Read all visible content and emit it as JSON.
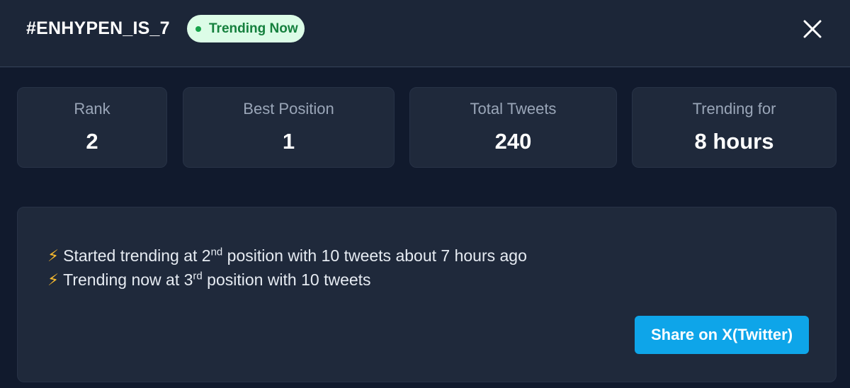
{
  "header": {
    "hashtag": "#ENHYPEN_IS_7",
    "badge_label": "Trending Now",
    "close_icon": "close-icon",
    "badge_dot_color": "#16a34a"
  },
  "stats": [
    {
      "label": "Rank",
      "value": "2"
    },
    {
      "label": "Best Position",
      "value": "1"
    },
    {
      "label": "Total Tweets",
      "value": "240"
    },
    {
      "label": "Trending for",
      "value": "8 hours"
    }
  ],
  "history": {
    "icon": "lightning-icon",
    "items": [
      {
        "prefix": "Started trending at 2",
        "ordinal": "nd",
        "suffix": " position with 10 tweets about 7 hours ago"
      },
      {
        "prefix": "Trending now at 3",
        "ordinal": "rd",
        "suffix": " position with 10 tweets"
      }
    ]
  },
  "share": {
    "label": "Share on X(Twitter)",
    "color": "#0ea5e9"
  }
}
